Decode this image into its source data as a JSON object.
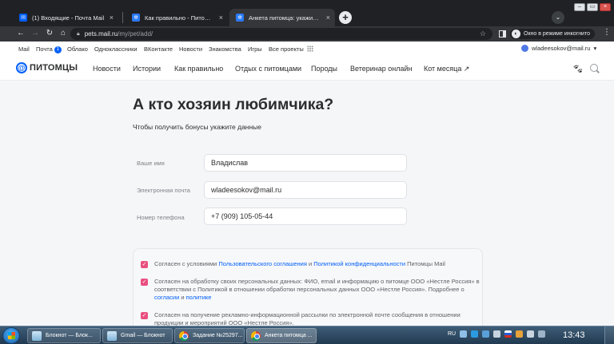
{
  "browser": {
    "tabs": [
      {
        "label": "(1) Входящие - Почта Mail",
        "close": "×"
      },
      {
        "label": "Как правильно - Питомцы Mail",
        "close": "×"
      },
      {
        "label": "Анкета питомца: укажите имя, ...",
        "close": "×"
      }
    ],
    "new_tab": "+",
    "url_host": "pets.mail.ru",
    "url_path": "/my/pet/add/",
    "incognito_label": "Окно в режиме инкогнито"
  },
  "portal_bar": {
    "items": [
      "Mail",
      "Почта",
      "Облако",
      "Одноклассники",
      "ВКонтакте",
      "Новости",
      "Знакомства",
      "Игры",
      "Все проекты"
    ],
    "mail_badge": "1",
    "account_email": "wladeesokov@mail.ru"
  },
  "header": {
    "logo_text": "ПИТОМЦЫ",
    "nav": [
      "Новости",
      "Истории",
      "Как правильно",
      "Отдых с питомцами",
      "Породы",
      "Ветеринар онлайн",
      "Кот месяца ↗"
    ]
  },
  "form": {
    "title": "А кто хозяин любимчика?",
    "subtitle": "Чтобы получить бонусы укажите данные",
    "fields": [
      {
        "label": "Ваше имя",
        "value": "Владислав"
      },
      {
        "label": "Электронная почта",
        "value": "wladeesokov@mail.ru"
      },
      {
        "label": "Номер телефона",
        "value": "+7 (909) 105-05-44"
      }
    ]
  },
  "consents": [
    {
      "checked": true,
      "t1": "Согласен с условиями ",
      "l1": "Пользовательского соглашения",
      "t2": " и ",
      "l2": "Политикой конфиденциальности",
      "t3": " Питомцы Mail"
    },
    {
      "checked": true,
      "t1": "Согласен на обработку своих персональных данных: ФИО, email и информацию о питомце ООО «Нестле Россия» в соответствии с Политикой в отношении обработки персональных данных ООО «Нестле Россия». Подробнее о ",
      "l1": "согласии",
      "t2": " и ",
      "l2": "политике",
      "t3": ""
    },
    {
      "checked": true,
      "t1": "Согласен на получение рекламно-информационной рассылки по электронной почте сообщения в отношении продукции и мероприятий ООО «Нестле Россия».",
      "l1": "",
      "t2": "",
      "l2": "",
      "t3": ""
    }
  ],
  "taskbar": {
    "buttons": [
      "Блокнот — Блок...",
      "Gmail — Блокнот",
      "Задание №25297...",
      "Анкета питомца ..."
    ],
    "lang": "RU",
    "time": "13:43"
  },
  "colors": {
    "accent": "#005ff9",
    "checkbox": "#e94f7f",
    "chrome_dark": "#202124"
  }
}
